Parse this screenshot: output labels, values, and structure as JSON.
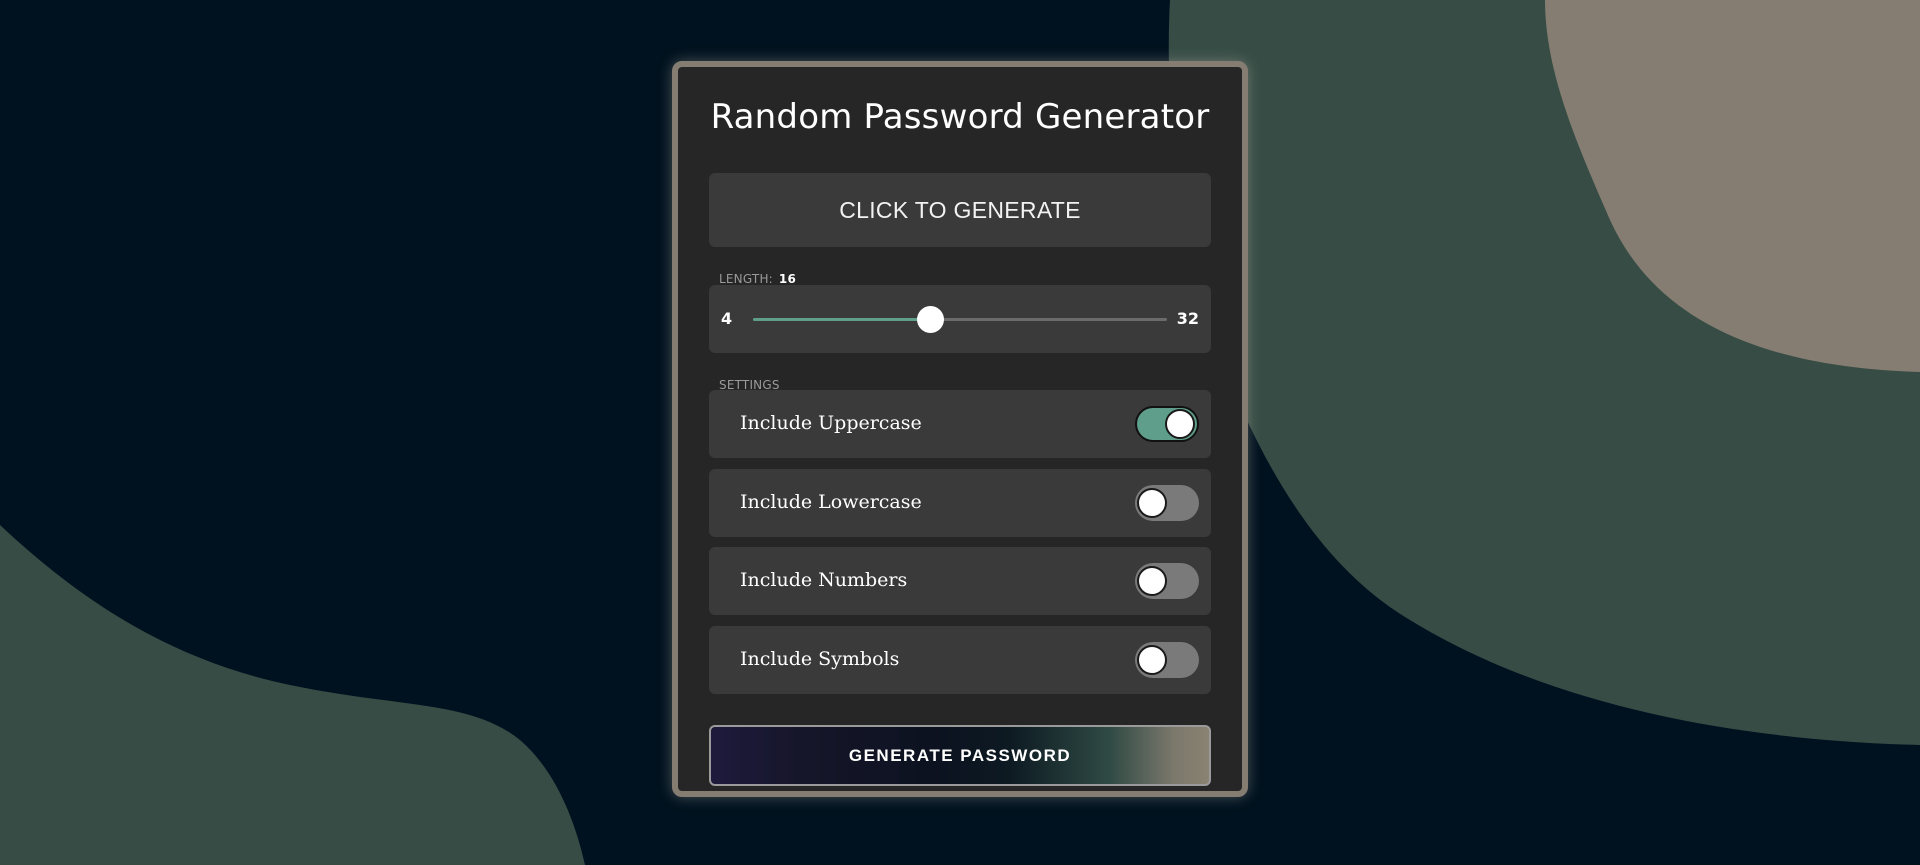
{
  "app": {
    "title": "Random Password Generator"
  },
  "password_display": {
    "text": "CLICK TO GENERATE"
  },
  "length": {
    "label": "LENGTH:",
    "value": "16",
    "min": "4",
    "max": "32",
    "current": 16
  },
  "settings": {
    "label": "SETTINGS",
    "items": [
      {
        "label": "Include Uppercase",
        "enabled": true
      },
      {
        "label": "Include Lowercase",
        "enabled": false
      },
      {
        "label": "Include Numbers",
        "enabled": false
      },
      {
        "label": "Include Symbols",
        "enabled": false
      }
    ]
  },
  "generate_button": {
    "label": "GENERATE PASSWORD"
  },
  "colors": {
    "background": "#00121f",
    "blob_green": "#364c45",
    "blob_taupe": "#857d72",
    "card": "#262626",
    "accent": "#5f9e8a"
  }
}
